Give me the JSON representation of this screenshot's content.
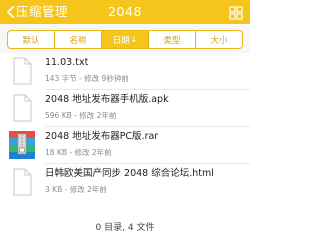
{
  "header": {
    "back_label": "压缩管理",
    "title": "2048",
    "bg_color": "#f6c51c"
  },
  "filter": {
    "tabs": [
      {
        "label": "默认",
        "active": false
      },
      {
        "label": "名称",
        "active": false
      },
      {
        "label": "日期",
        "active": true,
        "sort_icon": "↓"
      },
      {
        "label": "类型",
        "active": false
      },
      {
        "label": "大小",
        "active": false
      }
    ]
  },
  "files": [
    {
      "name": "11.03.txt",
      "meta": "143 字节 - 修改 9秒钟前",
      "icon": "document-icon"
    },
    {
      "name": "2048 地址发布器手机版.apk",
      "meta": "596 KB - 修改 2年前",
      "icon": "document-icon"
    },
    {
      "name": "2048 地址发布器PC版.rar",
      "meta": "18 KB - 修改 2年前",
      "icon": "archive-icon"
    },
    {
      "name": "日韩欧美国产同步 2048 综合论坛.html",
      "meta": "3 KB - 修改 2年前",
      "icon": "document-icon"
    }
  ],
  "summary": "0 目录, 4 文件"
}
